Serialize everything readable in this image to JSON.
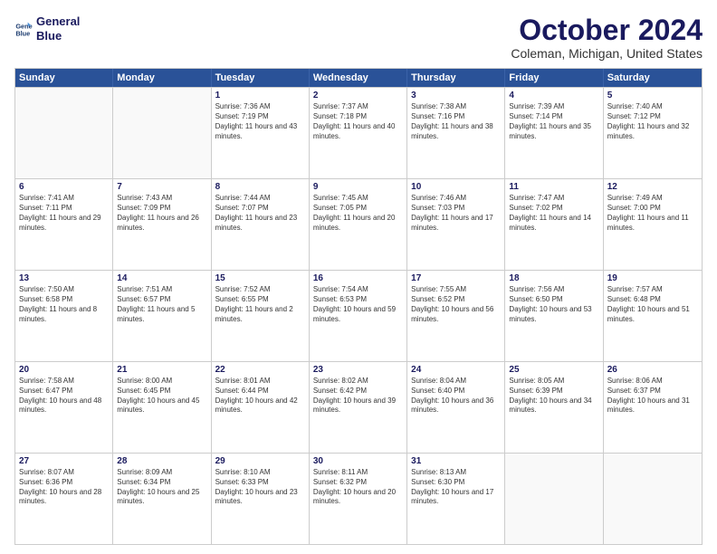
{
  "logo": {
    "line1": "General",
    "line2": "Blue"
  },
  "title": "October 2024",
  "subtitle": "Coleman, Michigan, United States",
  "header_days": [
    "Sunday",
    "Monday",
    "Tuesday",
    "Wednesday",
    "Thursday",
    "Friday",
    "Saturday"
  ],
  "weeks": [
    [
      {
        "day": "",
        "sunrise": "",
        "sunset": "",
        "daylight": ""
      },
      {
        "day": "",
        "sunrise": "",
        "sunset": "",
        "daylight": ""
      },
      {
        "day": "1",
        "sunrise": "Sunrise: 7:36 AM",
        "sunset": "Sunset: 7:19 PM",
        "daylight": "Daylight: 11 hours and 43 minutes."
      },
      {
        "day": "2",
        "sunrise": "Sunrise: 7:37 AM",
        "sunset": "Sunset: 7:18 PM",
        "daylight": "Daylight: 11 hours and 40 minutes."
      },
      {
        "day": "3",
        "sunrise": "Sunrise: 7:38 AM",
        "sunset": "Sunset: 7:16 PM",
        "daylight": "Daylight: 11 hours and 38 minutes."
      },
      {
        "day": "4",
        "sunrise": "Sunrise: 7:39 AM",
        "sunset": "Sunset: 7:14 PM",
        "daylight": "Daylight: 11 hours and 35 minutes."
      },
      {
        "day": "5",
        "sunrise": "Sunrise: 7:40 AM",
        "sunset": "Sunset: 7:12 PM",
        "daylight": "Daylight: 11 hours and 32 minutes."
      }
    ],
    [
      {
        "day": "6",
        "sunrise": "Sunrise: 7:41 AM",
        "sunset": "Sunset: 7:11 PM",
        "daylight": "Daylight: 11 hours and 29 minutes."
      },
      {
        "day": "7",
        "sunrise": "Sunrise: 7:43 AM",
        "sunset": "Sunset: 7:09 PM",
        "daylight": "Daylight: 11 hours and 26 minutes."
      },
      {
        "day": "8",
        "sunrise": "Sunrise: 7:44 AM",
        "sunset": "Sunset: 7:07 PM",
        "daylight": "Daylight: 11 hours and 23 minutes."
      },
      {
        "day": "9",
        "sunrise": "Sunrise: 7:45 AM",
        "sunset": "Sunset: 7:05 PM",
        "daylight": "Daylight: 11 hours and 20 minutes."
      },
      {
        "day": "10",
        "sunrise": "Sunrise: 7:46 AM",
        "sunset": "Sunset: 7:03 PM",
        "daylight": "Daylight: 11 hours and 17 minutes."
      },
      {
        "day": "11",
        "sunrise": "Sunrise: 7:47 AM",
        "sunset": "Sunset: 7:02 PM",
        "daylight": "Daylight: 11 hours and 14 minutes."
      },
      {
        "day": "12",
        "sunrise": "Sunrise: 7:49 AM",
        "sunset": "Sunset: 7:00 PM",
        "daylight": "Daylight: 11 hours and 11 minutes."
      }
    ],
    [
      {
        "day": "13",
        "sunrise": "Sunrise: 7:50 AM",
        "sunset": "Sunset: 6:58 PM",
        "daylight": "Daylight: 11 hours and 8 minutes."
      },
      {
        "day": "14",
        "sunrise": "Sunrise: 7:51 AM",
        "sunset": "Sunset: 6:57 PM",
        "daylight": "Daylight: 11 hours and 5 minutes."
      },
      {
        "day": "15",
        "sunrise": "Sunrise: 7:52 AM",
        "sunset": "Sunset: 6:55 PM",
        "daylight": "Daylight: 11 hours and 2 minutes."
      },
      {
        "day": "16",
        "sunrise": "Sunrise: 7:54 AM",
        "sunset": "Sunset: 6:53 PM",
        "daylight": "Daylight: 10 hours and 59 minutes."
      },
      {
        "day": "17",
        "sunrise": "Sunrise: 7:55 AM",
        "sunset": "Sunset: 6:52 PM",
        "daylight": "Daylight: 10 hours and 56 minutes."
      },
      {
        "day": "18",
        "sunrise": "Sunrise: 7:56 AM",
        "sunset": "Sunset: 6:50 PM",
        "daylight": "Daylight: 10 hours and 53 minutes."
      },
      {
        "day": "19",
        "sunrise": "Sunrise: 7:57 AM",
        "sunset": "Sunset: 6:48 PM",
        "daylight": "Daylight: 10 hours and 51 minutes."
      }
    ],
    [
      {
        "day": "20",
        "sunrise": "Sunrise: 7:58 AM",
        "sunset": "Sunset: 6:47 PM",
        "daylight": "Daylight: 10 hours and 48 minutes."
      },
      {
        "day": "21",
        "sunrise": "Sunrise: 8:00 AM",
        "sunset": "Sunset: 6:45 PM",
        "daylight": "Daylight: 10 hours and 45 minutes."
      },
      {
        "day": "22",
        "sunrise": "Sunrise: 8:01 AM",
        "sunset": "Sunset: 6:44 PM",
        "daylight": "Daylight: 10 hours and 42 minutes."
      },
      {
        "day": "23",
        "sunrise": "Sunrise: 8:02 AM",
        "sunset": "Sunset: 6:42 PM",
        "daylight": "Daylight: 10 hours and 39 minutes."
      },
      {
        "day": "24",
        "sunrise": "Sunrise: 8:04 AM",
        "sunset": "Sunset: 6:40 PM",
        "daylight": "Daylight: 10 hours and 36 minutes."
      },
      {
        "day": "25",
        "sunrise": "Sunrise: 8:05 AM",
        "sunset": "Sunset: 6:39 PM",
        "daylight": "Daylight: 10 hours and 34 minutes."
      },
      {
        "day": "26",
        "sunrise": "Sunrise: 8:06 AM",
        "sunset": "Sunset: 6:37 PM",
        "daylight": "Daylight: 10 hours and 31 minutes."
      }
    ],
    [
      {
        "day": "27",
        "sunrise": "Sunrise: 8:07 AM",
        "sunset": "Sunset: 6:36 PM",
        "daylight": "Daylight: 10 hours and 28 minutes."
      },
      {
        "day": "28",
        "sunrise": "Sunrise: 8:09 AM",
        "sunset": "Sunset: 6:34 PM",
        "daylight": "Daylight: 10 hours and 25 minutes."
      },
      {
        "day": "29",
        "sunrise": "Sunrise: 8:10 AM",
        "sunset": "Sunset: 6:33 PM",
        "daylight": "Daylight: 10 hours and 23 minutes."
      },
      {
        "day": "30",
        "sunrise": "Sunrise: 8:11 AM",
        "sunset": "Sunset: 6:32 PM",
        "daylight": "Daylight: 10 hours and 20 minutes."
      },
      {
        "day": "31",
        "sunrise": "Sunrise: 8:13 AM",
        "sunset": "Sunset: 6:30 PM",
        "daylight": "Daylight: 10 hours and 17 minutes."
      },
      {
        "day": "",
        "sunrise": "",
        "sunset": "",
        "daylight": ""
      },
      {
        "day": "",
        "sunrise": "",
        "sunset": "",
        "daylight": ""
      }
    ]
  ]
}
